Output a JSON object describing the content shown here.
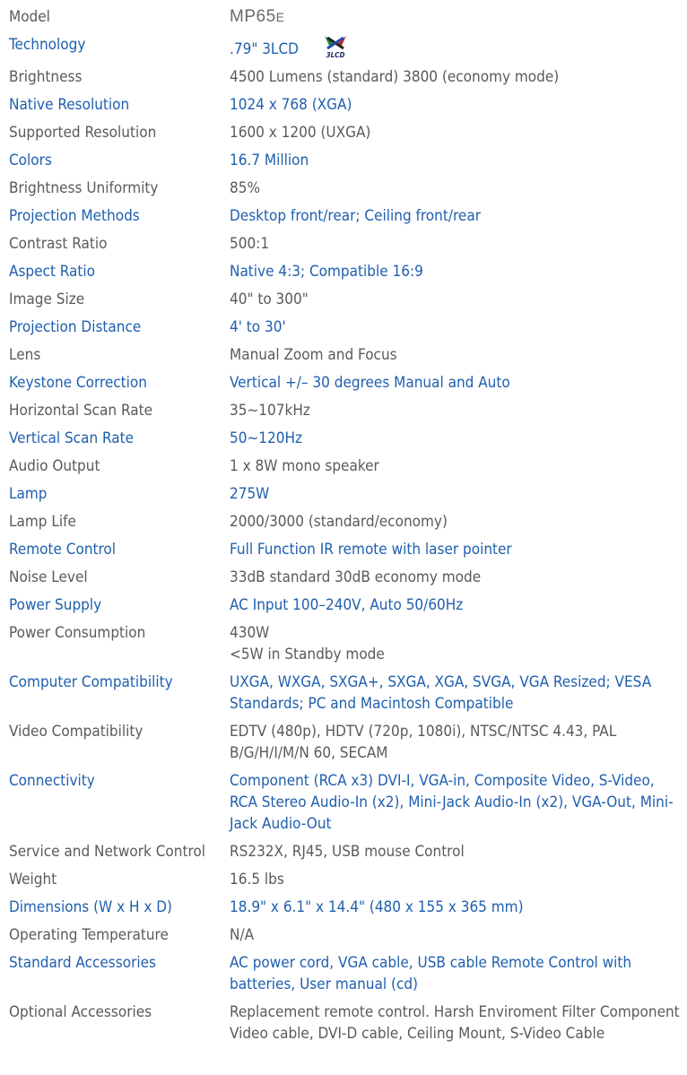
{
  "specs": [
    {
      "label": "Model",
      "value": "MP65",
      "value_suffix": "E",
      "style": "gray",
      "kind": "model"
    },
    {
      "label": "Technology",
      "value": ".79\" 3LCD",
      "style": "blue",
      "kind": "tech",
      "logo_text": "3LCD"
    },
    {
      "label": "Brightness",
      "value": "4500 Lumens (standard) 3800 (economy mode)",
      "style": "gray"
    },
    {
      "label": "Native Resolution",
      "value": "1024 x 768 (XGA)",
      "style": "blue"
    },
    {
      "label": "Supported Resolution",
      "value": "1600 x 1200 (UXGA)",
      "style": "gray"
    },
    {
      "label": "Colors",
      "value": "16.7 Million",
      "style": "blue"
    },
    {
      "label": "Brightness Uniformity",
      "value": "85%",
      "style": "gray"
    },
    {
      "label": "Projection Methods",
      "value": "Desktop front/rear; Ceiling front/rear",
      "style": "blue"
    },
    {
      "label": "Contrast Ratio",
      "value": "500:1",
      "style": "gray"
    },
    {
      "label": "Aspect Ratio",
      "value": "Native 4:3; Compatible 16:9",
      "style": "blue"
    },
    {
      "label": "Image Size",
      "value": "40\" to 300\"",
      "style": "gray"
    },
    {
      "label": "Projection Distance",
      "value": "4' to 30'",
      "style": "blue"
    },
    {
      "label": "Lens",
      "value": "Manual Zoom and Focus",
      "style": "gray"
    },
    {
      "label": "Keystone Correction",
      "value": "Vertical +/– 30 degrees Manual and Auto",
      "style": "blue"
    },
    {
      "label": "Horizontal Scan Rate",
      "value": "35~107kHz",
      "style": "gray"
    },
    {
      "label": "Vertical Scan Rate",
      "value": "50~120Hz",
      "style": "blue"
    },
    {
      "label": "Audio Output",
      "value": "1 x 8W mono speaker",
      "style": "gray"
    },
    {
      "label": "Lamp",
      "value": "275W",
      "style": "blue"
    },
    {
      "label": "Lamp Life",
      "value": "2000/3000 (standard/economy)",
      "style": "gray"
    },
    {
      "label": "Remote Control",
      "value": "Full Function IR remote with laser pointer",
      "style": "blue"
    },
    {
      "label": "Noise Level",
      "value": "33dB standard 30dB economy mode",
      "style": "gray"
    },
    {
      "label": "Power Supply",
      "value": "AC Input 100–240V, Auto 50/60Hz",
      "style": "blue"
    },
    {
      "label": "Power Consumption",
      "value": "430W\n<5W in Standby mode",
      "style": "gray"
    },
    {
      "label": "Computer Compatibility",
      "value": "UXGA, WXGA, SXGA+, SXGA, XGA, SVGA, VGA Resized; VESA Standards; PC and Macintosh Compatible",
      "style": "blue"
    },
    {
      "label": "Video Compatibility",
      "value": "EDTV (480p), HDTV (720p, 1080i), NTSC/NTSC 4.43, PAL B/G/H/I/M/N 60, SECAM",
      "style": "gray"
    },
    {
      "label": "Connectivity",
      "value": "Component (RCA x3) DVI-I, VGA-in, Composite Video, S-Video, RCA Stereo Audio-In (x2), Mini-Jack Audio-In (x2), VGA-Out, Mini-Jack Audio-Out",
      "style": "blue"
    },
    {
      "label": "Service and Network Control",
      "value": "RS232X, RJ45, USB mouse Control",
      "style": "gray"
    },
    {
      "label": "Weight",
      "value": "16.5 lbs",
      "style": "gray"
    },
    {
      "label": "Dimensions (W x H x D)",
      "value": "18.9\" x 6.1\" x 14.4\" (480 x 155 x 365 mm)",
      "style": "blue"
    },
    {
      "label": "Operating Temperature",
      "value": "N/A",
      "style": "gray"
    },
    {
      "label": "Standard Accessories",
      "value": "AC power cord, VGA cable, USB cable Remote Control with batteries, User manual (cd)",
      "style": "blue"
    },
    {
      "label": "Optional Accessories",
      "value": "Replacement remote control. Harsh Enviroment Filter Component Video cable, DVI-D cable, Ceiling Mount, S-Video Cable",
      "style": "gray"
    }
  ]
}
